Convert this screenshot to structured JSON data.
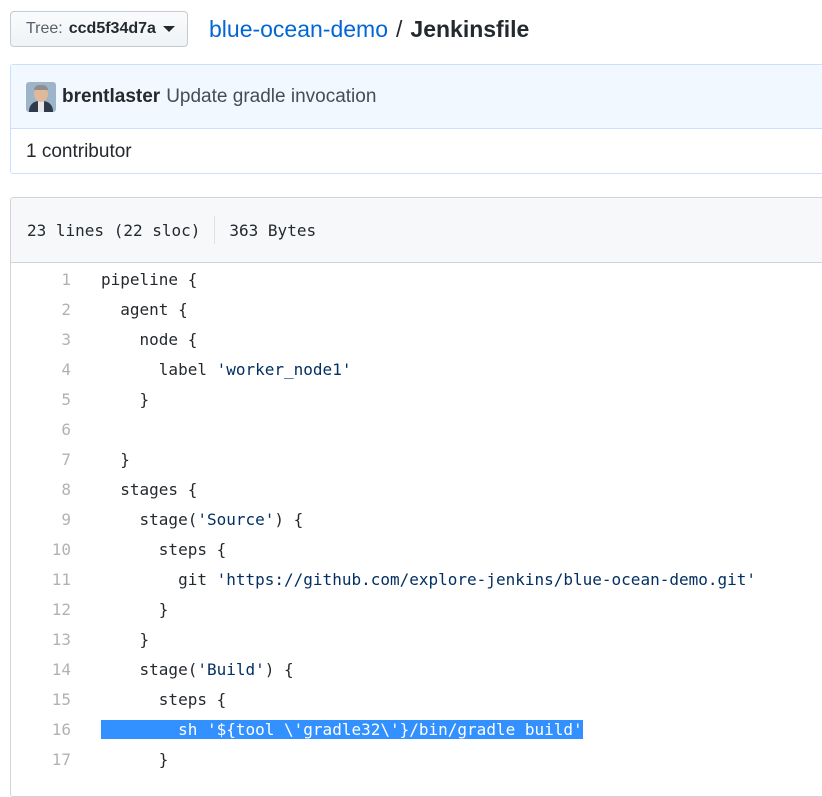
{
  "topbar": {
    "tree_prefix": "Tree:",
    "tree_sha": "ccd5f34d7a",
    "repo_name": "blue-ocean-demo",
    "separator": "/",
    "file_name": "Jenkinsfile"
  },
  "commit": {
    "author": "brentlaster",
    "message": "Update gradle invocation",
    "contributors": "1 contributor"
  },
  "file": {
    "lines_info": "23 lines (22 sloc)",
    "size": "363 Bytes"
  },
  "code_lines": [
    {
      "num": "1",
      "pre": "pipeline {",
      "str": "",
      "post": ""
    },
    {
      "num": "2",
      "pre": "  agent {",
      "str": "",
      "post": ""
    },
    {
      "num": "3",
      "pre": "    node {",
      "str": "",
      "post": ""
    },
    {
      "num": "4",
      "pre": "      label ",
      "str": "'worker_node1'",
      "post": ""
    },
    {
      "num": "5",
      "pre": "    }",
      "str": "",
      "post": ""
    },
    {
      "num": "6",
      "pre": "",
      "str": "",
      "post": ""
    },
    {
      "num": "7",
      "pre": "  }",
      "str": "",
      "post": ""
    },
    {
      "num": "8",
      "pre": "  stages {",
      "str": "",
      "post": ""
    },
    {
      "num": "9",
      "pre": "    stage(",
      "str": "'Source'",
      "post": ") {"
    },
    {
      "num": "10",
      "pre": "      steps {",
      "str": "",
      "post": ""
    },
    {
      "num": "11",
      "pre": "        git ",
      "str": "'https://github.com/explore-jenkins/blue-ocean-demo.git'",
      "post": ""
    },
    {
      "num": "12",
      "pre": "      }",
      "str": "",
      "post": ""
    },
    {
      "num": "13",
      "pre": "    }",
      "str": "",
      "post": ""
    },
    {
      "num": "14",
      "pre": "    stage(",
      "str": "'Build'",
      "post": ") {"
    },
    {
      "num": "15",
      "pre": "      steps {",
      "str": "",
      "post": ""
    },
    {
      "num": "16",
      "pre": "        sh '${tool \\'gradle32\\'}/bin/gradle build'",
      "str": "",
      "post": "",
      "selected": true
    },
    {
      "num": "17",
      "pre": "      }",
      "str": "",
      "post": ""
    }
  ],
  "colors": {
    "link": "#0366d6",
    "selection": "#3390ff",
    "string": "#032f62",
    "commit_bg": "#f1f8ff"
  }
}
